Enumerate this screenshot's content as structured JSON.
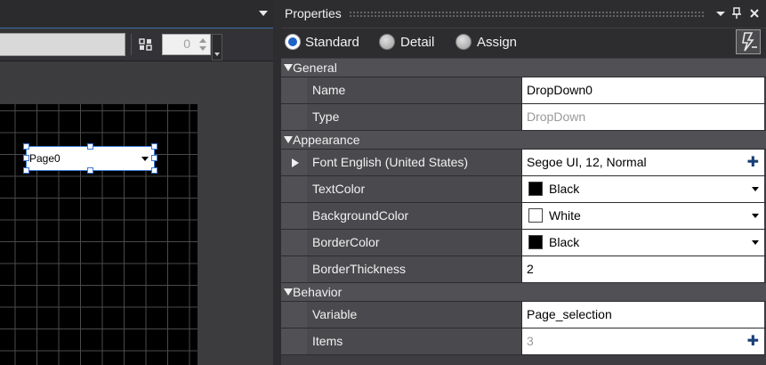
{
  "designer": {
    "spin_value": "0",
    "dropdown_widget_text": "Page0"
  },
  "properties": {
    "title": "Properties",
    "title_buttons": {
      "menu": "▾",
      "pin": "📌",
      "close": "✕"
    },
    "view_modes": [
      {
        "label": "Standard",
        "selected": true
      },
      {
        "label": "Detail",
        "selected": false
      },
      {
        "label": "Assign",
        "selected": false
      }
    ],
    "categories": {
      "general": "General",
      "appearance": "Appearance",
      "behavior": "Behavior"
    },
    "rows": {
      "name": {
        "label": "Name",
        "value": "DropDown0"
      },
      "type": {
        "label": "Type",
        "value": "DropDown"
      },
      "font": {
        "label": "Font English (United States)",
        "value": "Segoe UI, 12, Normal"
      },
      "text_color": {
        "label": "TextColor",
        "value": "Black",
        "swatch": "#000000"
      },
      "background_color": {
        "label": "BackgroundColor",
        "value": "White",
        "swatch": "#ffffff"
      },
      "border_color": {
        "label": "BorderColor",
        "value": "Black",
        "swatch": "#000000"
      },
      "border_thickness": {
        "label": "BorderThickness",
        "value": "2"
      },
      "variable": {
        "label": "Variable",
        "value": "Page_selection"
      },
      "items": {
        "label": "Items",
        "value": "3"
      }
    }
  },
  "colors": {
    "accent": "#1e64c8",
    "panel_bg": "#3e3e42",
    "category_bg": "#505055"
  }
}
